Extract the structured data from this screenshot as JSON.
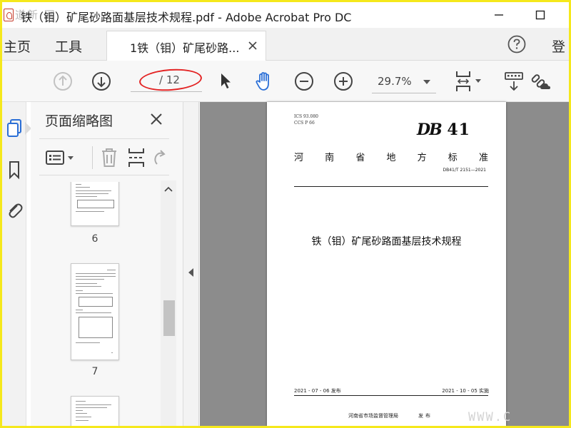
{
  "window": {
    "title": "铁（钼）矿尾砂路面基层技术规程.pdf - Adobe Acrobat Pro DC",
    "watermark_text": "道新 网"
  },
  "tabs": {
    "home": "主页",
    "tools": "工具",
    "document_tab": "1铁（钼）矿尾砂路...",
    "login": "登"
  },
  "toolbar": {
    "page_current": "",
    "page_total": "/ 12",
    "zoom": "29.7%"
  },
  "thumbnails_panel": {
    "title": "页面缩略图",
    "pages": [
      {
        "label": "6"
      },
      {
        "label": "7"
      },
      {
        "label": ""
      }
    ]
  },
  "page": {
    "ics": "ICS  93.080",
    "ccs": "CCS  P  66",
    "logo_letters": "DB",
    "logo_number": "41",
    "standard_type_chars": [
      "河",
      "南",
      "省",
      "地",
      "方",
      "标",
      "准"
    ],
    "code": "DB41/T  2151—2021",
    "title": "铁（钼）矿尾砂路面基层技术规程",
    "publish_date": "2021 - 07 - 06 发布",
    "effective_date": "2021 - 10 - 05 实施",
    "issuer": "河南省市场监督管理局",
    "issue_word": "发布"
  },
  "doc_watermark": "WWW.C",
  "colors": {
    "frame_border": "#f5e81c",
    "annotation_ellipse": "#e32424",
    "accent_blue": "#2b6fd6",
    "document_background": "#8c8c8c"
  }
}
